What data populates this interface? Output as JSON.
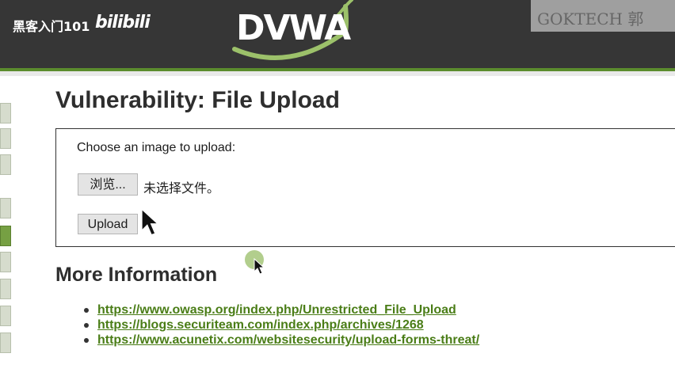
{
  "watermark": {
    "text": "黑客入门101",
    "logo": "bilibili"
  },
  "header": {
    "logo": "DVWA",
    "brand": "GOKTECH 郭"
  },
  "page": {
    "title": "Vulnerability: File Upload"
  },
  "upload_form": {
    "prompt": "Choose an image to upload:",
    "browse_label": "浏览...",
    "file_status": "未选择文件。",
    "upload_label": "Upload"
  },
  "more_info": {
    "title": "More Information",
    "links": [
      "https://www.owasp.org/index.php/Unrestricted_File_Upload",
      "https://blogs.securiteam.com/index.php/archives/1268",
      "https://www.acunetix.com/websitesecurity/upload-forms-threat/"
    ]
  },
  "colors": {
    "header_bg": "#363636",
    "accent": "#5b8c2d",
    "link": "#4a7d17",
    "menu_active": "#76a043"
  },
  "icons": [
    "dvwa-swoosh-logo",
    "arrow-cursor-icon",
    "arrow-cursor-small-icon"
  ]
}
